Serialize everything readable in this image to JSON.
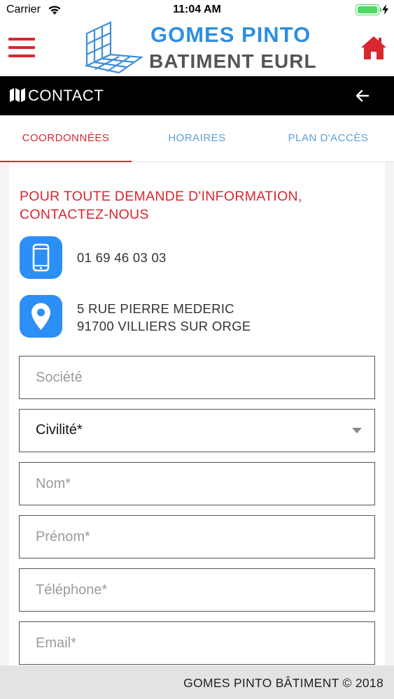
{
  "status_bar": {
    "carrier": "Carrier",
    "time": "11:04 AM",
    "battery_level": 1.0
  },
  "header": {
    "brand_line1": "GOMES PINTO",
    "brand_line2": "BATIMENT EURL",
    "menu_icon": "hamburger-icon",
    "home_icon": "home-icon"
  },
  "titlebar": {
    "title": "CONTACT",
    "icon": "map-icon",
    "back_icon": "arrow-left-icon"
  },
  "tabs": [
    {
      "label": "COORDONNÉES",
      "active": true
    },
    {
      "label": "HORAIRES",
      "active": false
    },
    {
      "label": "PLAN D'ACCÈS",
      "active": false
    }
  ],
  "contact": {
    "heading": "POUR TOUTE DEMANDE D'INFORMATION, CONTACTEZ-NOUS",
    "phone": "01 69 46 03 03",
    "address_line1": "5 RUE PIERRE MEDERIC",
    "address_line2": "91700 VILLIERS SUR ORGE"
  },
  "form": {
    "societe_placeholder": "Société",
    "civilite_value": "Civilité*",
    "nom_placeholder": "Nom*",
    "prenom_placeholder": "Prénom*",
    "telephone_placeholder": "Téléphone*",
    "email_placeholder": "Email*"
  },
  "footer": {
    "copyright": "GOMES PINTO BÂTIMENT © 2018"
  },
  "colors": {
    "accent_red": "#d9262f",
    "brand_blue": "#2f8fe0",
    "icon_blue": "#2b8ff5",
    "tab_blue": "#5ea0d6"
  }
}
